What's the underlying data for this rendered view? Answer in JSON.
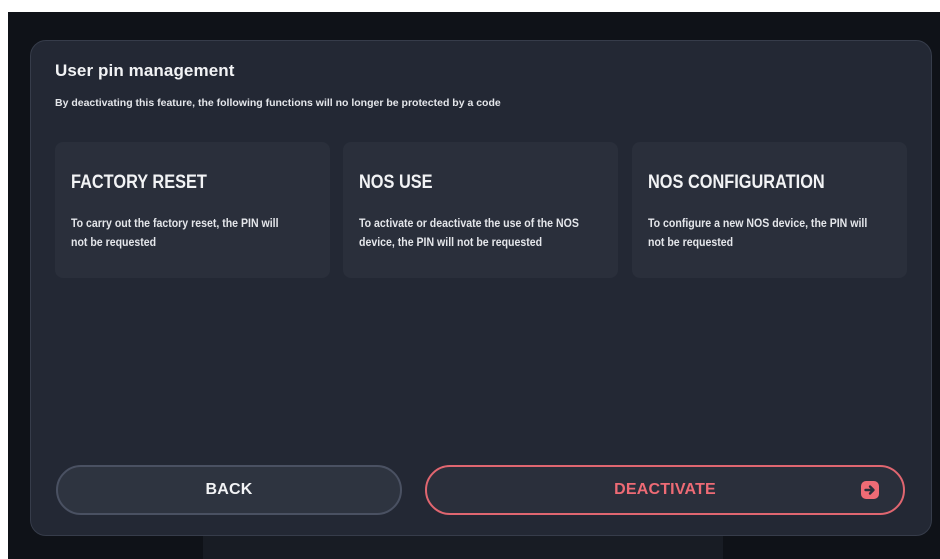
{
  "dialog": {
    "title": "User pin management",
    "subtitle": "By deactivating this feature, the following functions will no longer be protected by a code"
  },
  "cards": [
    {
      "title": "FACTORY RESET",
      "description": "To carry out the factory reset, the PIN will not be requested"
    },
    {
      "title": "NOS USE",
      "description": "To activate or deactivate the use of the NOS device, the PIN will not be requested"
    },
    {
      "title": "NOS CONFIGURATION",
      "description": "To configure a new NOS device, the PIN will not be requested"
    }
  ],
  "buttons": {
    "back_label": "BACK",
    "deactivate_label": "DEACTIVATE",
    "deactivate_icon": "arrow-right-square-icon"
  },
  "colors": {
    "background": "#0f1218",
    "panel": "#232834",
    "card": "#2a2f3b",
    "accent": "#ee6b75"
  }
}
